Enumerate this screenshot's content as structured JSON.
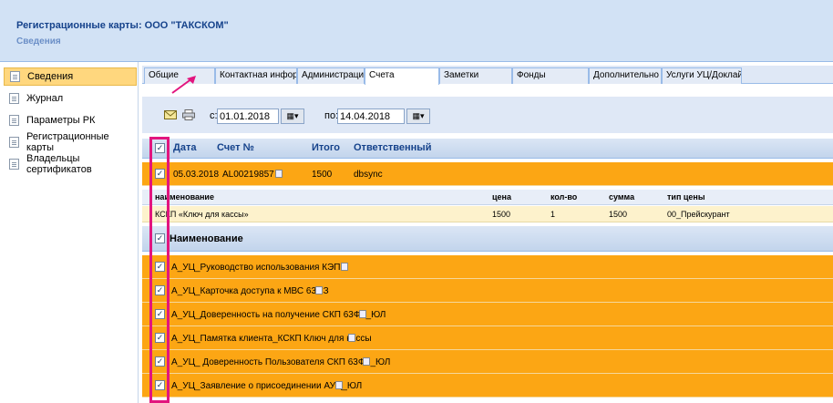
{
  "header": {
    "title": "Регистрационные карты: ООО \"ТАКСКОМ\"",
    "subtitle": "Сведения"
  },
  "sidebar": {
    "items": [
      {
        "label": "Сведения",
        "active": true
      },
      {
        "label": "Журнал"
      },
      {
        "label": "Параметры РК"
      },
      {
        "label": "Регистрационные карты"
      },
      {
        "label": "Владельцы сертификатов"
      }
    ]
  },
  "tabs": [
    "Общие",
    "Контактная инфорн",
    "Администрация",
    "Счета",
    "Заметки",
    "Фонды",
    "Дополнительно",
    "Услуги УЦ/Доклайн"
  ],
  "toolbar": {
    "from_label": "с:",
    "from_value": "01.01.2018",
    "to_label": "по:",
    "to_value": "14.04.2018"
  },
  "grid": {
    "columns": {
      "check": "✓",
      "date": "Дата",
      "account": "Счет №",
      "total": "Итого",
      "responsible": "Ответственный"
    },
    "row": {
      "date": "05.03.2018",
      "account": "AL00219857",
      "total": "1500",
      "responsible": "dbsync"
    },
    "detail_headers": {
      "name": "наименование",
      "price": "цена",
      "qty": "кол-во",
      "sum": "сумма",
      "price_type": "тип цены"
    },
    "detail_row": {
      "name": "КСКП «Ключ для кассы»",
      "price": "1500",
      "qty": "1",
      "sum": "1500",
      "price_type": "00_Прейскурант"
    }
  },
  "docs": {
    "header": "Наименование",
    "items": [
      "А_УЦ_Руководство использования КЭП",
      "А_УЦ_Карточка доступа к МВС 63ФЗ",
      "А_УЦ_Доверенность на получение СКП 63ФЗ_ЮЛ",
      "А_УЦ_Памятка клиента_КСКП Ключ для кассы",
      "А_УЦ_ Доверенность Пользователя СКП 63ФЗ_ЮЛ",
      "А_УЦ_Заявление о присоединении АУЦ_ЮЛ"
    ]
  },
  "colors": {
    "highlight": "#fca614",
    "annotation": "#e2157e"
  },
  "icons": [
    "doc-icon",
    "email-icon",
    "print-icon",
    "calendar-icon",
    "arrow-icon"
  ]
}
